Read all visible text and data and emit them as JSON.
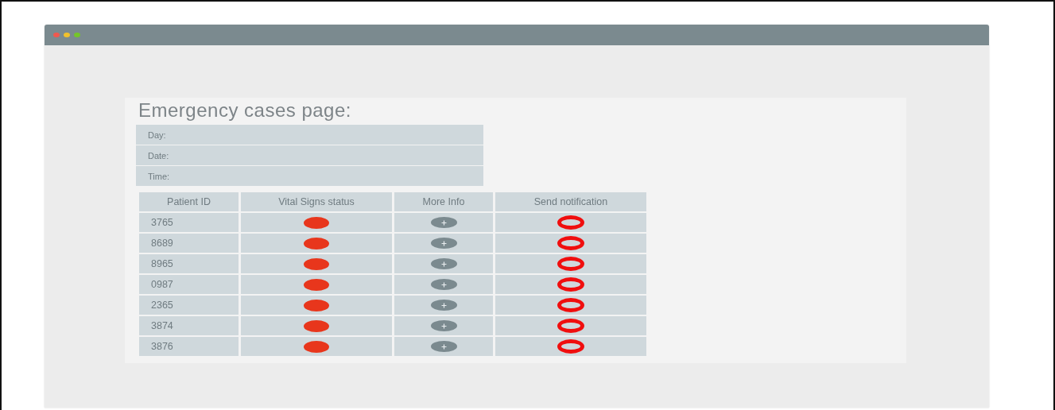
{
  "title": "Emergency cases page:",
  "fields": [
    {
      "placeholder": "Day:"
    },
    {
      "placeholder": "Date:"
    },
    {
      "placeholder": "Time:"
    }
  ],
  "table": {
    "columns": [
      "Patient ID",
      "Vital Signs status",
      "More Info",
      "Send notification"
    ],
    "rows": [
      {
        "patient_id": "3765"
      },
      {
        "patient_id": "8689"
      },
      {
        "patient_id": "8965"
      },
      {
        "patient_id": "0987"
      },
      {
        "patient_id": "2365"
      },
      {
        "patient_id": "3874"
      },
      {
        "patient_id": "3876"
      }
    ]
  }
}
